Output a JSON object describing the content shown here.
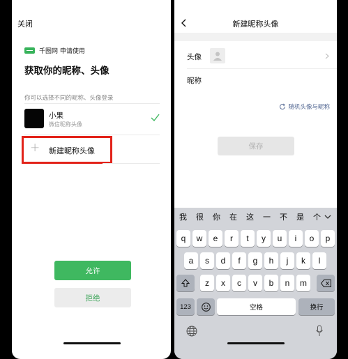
{
  "left": {
    "close_label": "关闭",
    "app_line": "千图网 申请使用",
    "title": "获取你的昵称、头像",
    "subtitle": "你可以选择不同的昵称、头像登录",
    "profile": {
      "name": "小果",
      "sub": "微信昵称头像",
      "avatar_glyph": ""
    },
    "new_label": "新建昵称头像",
    "allow_label": "允许",
    "deny_label": "拒绝"
  },
  "right": {
    "title": "新建昵称头像",
    "avatar_label": "头像",
    "nickname_label": "昵称",
    "random_label": "随机头像与昵称",
    "save_label": "保存",
    "keyboard": {
      "candidates": [
        "我",
        "很",
        "你",
        "在",
        "这",
        "一",
        "不",
        "是",
        "个"
      ],
      "row1": [
        "q",
        "w",
        "e",
        "r",
        "t",
        "y",
        "u",
        "i",
        "o",
        "p"
      ],
      "row2": [
        "a",
        "s",
        "d",
        "f",
        "g",
        "h",
        "j",
        "k",
        "l"
      ],
      "row3": [
        "z",
        "x",
        "c",
        "v",
        "b",
        "n",
        "m"
      ],
      "num_label": "123",
      "space_label": "空格",
      "return_label": "换行"
    }
  },
  "colors": {
    "accent": "#3fb860",
    "highlight": "#e2231a",
    "link": "#576b95"
  }
}
